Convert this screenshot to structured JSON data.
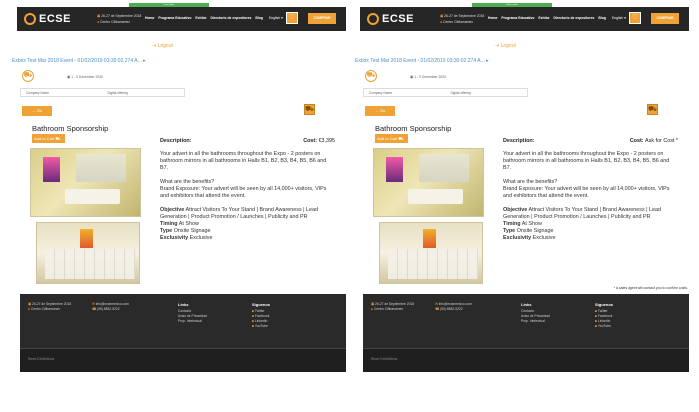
{
  "header": {
    "logo_text": "ECSE",
    "logo_sub": "ENERGY · CONGRESS · SHOW · EXPO",
    "green_strip": "Event notice",
    "date": "26-27 de Septiembre 2018",
    "venue": "Centro Citibanamex",
    "nav": [
      "Home",
      "Programa Educativo",
      "Exhibe",
      "Directorio de expositores",
      "Blog"
    ],
    "lang": "English ▾",
    "buy_label": "COMPRAR"
  },
  "logout": "Logout",
  "breadcrumb": "Exbox Test Mar 2018 Event - 01/02/2019 03:30:02.274 A... ▸",
  "date_line": "1 - 9 December 2020",
  "table": {
    "col1": "Company Name",
    "col2": "Digital offering"
  },
  "back_label": "← Go",
  "product": {
    "title": "Bathroom Sponsorship",
    "add_to_cart": "Add to Cart",
    "description_label": "Description:",
    "cost_label": "Cost:",
    "cost_left": "€3,395",
    "cost_right": "Ask for Cost *",
    "desc1": "Your advert in all the bathrooms throughout the Expo - 2 posters on bathroom mirrors in all bathrooms in Halls B1, B2, B3, B4, B5, B6 and B7.",
    "desc2": "What are the benefits?",
    "desc3": "Brand Exposure: Your advert will be seen by all 14,000+ visitors, VIPs and exhibitors that attend the event.",
    "objective_label": "Objective",
    "objective": "Attract Visitors To Your Stand | Brand Awareness | Lead Generation | Product Promotion / Launches | Publicity and PR",
    "timing_label": "Timing",
    "timing": "At Show",
    "type_label": "Type",
    "type": "Onsite Signage",
    "exclusivity_label": "Exclusivity",
    "exclusivity": "Exclusive"
  },
  "note": "* A sales agent will contact you to confirm costs.",
  "footer": {
    "date": "26-27 de Septiembre 2018",
    "venue": "Centro Citibanamex",
    "email": "info@ecsemexico.com",
    "phone": "(55) 8852-5222",
    "links_title": "Links",
    "links": [
      "Contacto",
      "Aviso de Privacidad",
      "Prop. Intelectual"
    ],
    "follow_title": "Síguenos",
    "social": [
      "Twitter",
      "Facebook",
      "LinkedIn",
      "YouTube"
    ],
    "brand": "Reed Exhibitions"
  },
  "colors": {
    "accent": "#f0a236",
    "dark": "#262626",
    "link": "#4a90c8"
  }
}
